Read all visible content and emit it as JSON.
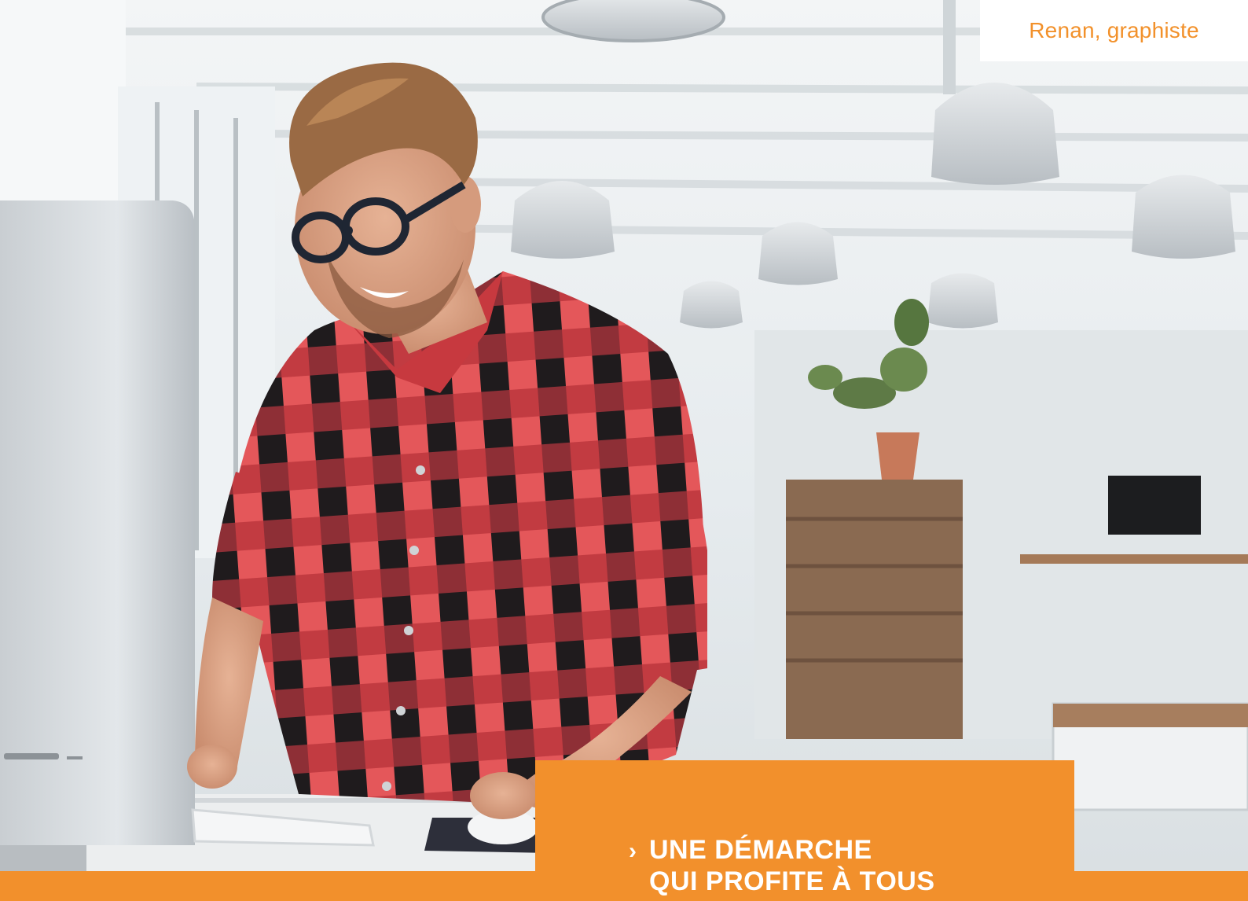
{
  "photo": {
    "subject": "Homme souriant portant des lunettes et une chemise à carreaux rouge et noir, debout devant un ordinateur dans un bureau lumineux"
  },
  "caption": {
    "text": "Renan, graphiste",
    "color": "#f2912b"
  },
  "headline": {
    "chevron": "›",
    "line1": "UNE DÉMARCHE",
    "line2": "QUI PROFITE À TOUS"
  },
  "colors": {
    "accent_orange": "#f2902c",
    "shirt_red": "#e2474a",
    "shirt_black": "#1d1a1c"
  }
}
